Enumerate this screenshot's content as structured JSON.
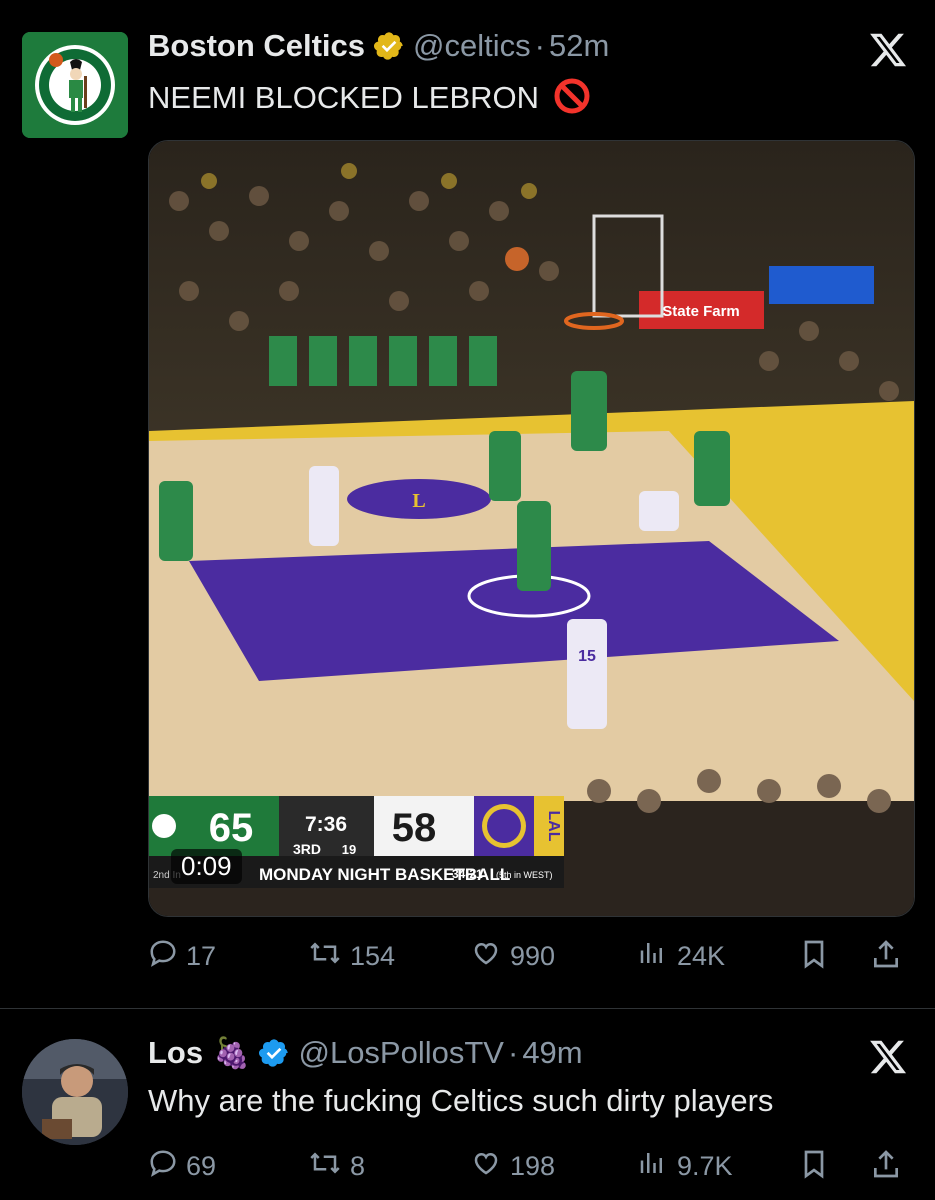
{
  "tweet1": {
    "name": "Boston Celtics",
    "handle": "@celtics",
    "time": "52m",
    "text": "NEEMI BLOCKED LEBRON",
    "video": {
      "duration": "0:09",
      "scorebug": {
        "home_score": "65",
        "clock": "7:36",
        "quarter": "3RD",
        "shot_clock": "19",
        "away_score": "58",
        "away_team": "LAL",
        "banner": "2nd In",
        "show": "MONDAY NIGHT BASKETBALL",
        "record": "34-21",
        "standing": "(5th in WEST)"
      },
      "sponsor": "State Farm",
      "player_number": "15"
    },
    "actions": {
      "replies": "17",
      "reposts": "154",
      "likes": "990",
      "views": "24K"
    }
  },
  "tweet2": {
    "name": "Los",
    "emoji": "🍇",
    "handle": "@LosPollosTV",
    "time": "49m",
    "text": "Why are the fucking Celtics such dirty players",
    "actions": {
      "replies": "69",
      "reposts": "8",
      "likes": "198",
      "views": "9.7K"
    }
  },
  "colors": {
    "verified_gold": "#e2b719",
    "verified_blue": "#1d9bf0",
    "muted": "#8b98a5"
  },
  "icons": [
    "reply-icon",
    "repost-icon",
    "like-icon",
    "views-icon",
    "bookmark-icon",
    "share-icon",
    "x-logo-icon",
    "verified-icon",
    "no-entry-emoji"
  ]
}
